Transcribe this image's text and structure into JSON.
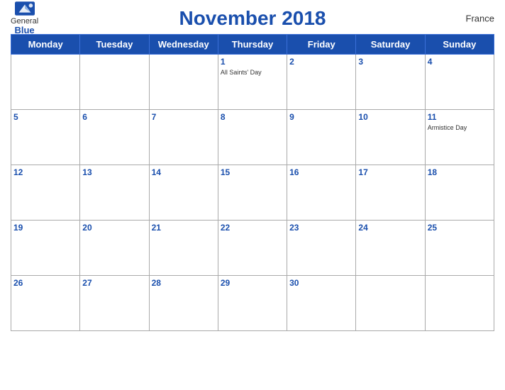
{
  "header": {
    "logo_general": "General",
    "logo_blue": "Blue",
    "title": "November 2018",
    "country": "France"
  },
  "weekdays": [
    "Monday",
    "Tuesday",
    "Wednesday",
    "Thursday",
    "Friday",
    "Saturday",
    "Sunday"
  ],
  "weeks": [
    [
      {
        "day": "",
        "holiday": ""
      },
      {
        "day": "",
        "holiday": ""
      },
      {
        "day": "",
        "holiday": ""
      },
      {
        "day": "1",
        "holiday": "All Saints' Day"
      },
      {
        "day": "2",
        "holiday": ""
      },
      {
        "day": "3",
        "holiday": ""
      },
      {
        "day": "4",
        "holiday": ""
      }
    ],
    [
      {
        "day": "5",
        "holiday": ""
      },
      {
        "day": "6",
        "holiday": ""
      },
      {
        "day": "7",
        "holiday": ""
      },
      {
        "day": "8",
        "holiday": ""
      },
      {
        "day": "9",
        "holiday": ""
      },
      {
        "day": "10",
        "holiday": ""
      },
      {
        "day": "11",
        "holiday": "Armistice Day"
      }
    ],
    [
      {
        "day": "12",
        "holiday": ""
      },
      {
        "day": "13",
        "holiday": ""
      },
      {
        "day": "14",
        "holiday": ""
      },
      {
        "day": "15",
        "holiday": ""
      },
      {
        "day": "16",
        "holiday": ""
      },
      {
        "day": "17",
        "holiday": ""
      },
      {
        "day": "18",
        "holiday": ""
      }
    ],
    [
      {
        "day": "19",
        "holiday": ""
      },
      {
        "day": "20",
        "holiday": ""
      },
      {
        "day": "21",
        "holiday": ""
      },
      {
        "day": "22",
        "holiday": ""
      },
      {
        "day": "23",
        "holiday": ""
      },
      {
        "day": "24",
        "holiday": ""
      },
      {
        "day": "25",
        "holiday": ""
      }
    ],
    [
      {
        "day": "26",
        "holiday": ""
      },
      {
        "day": "27",
        "holiday": ""
      },
      {
        "day": "28",
        "holiday": ""
      },
      {
        "day": "29",
        "holiday": ""
      },
      {
        "day": "30",
        "holiday": ""
      },
      {
        "day": "",
        "holiday": ""
      },
      {
        "day": "",
        "holiday": ""
      }
    ]
  ]
}
